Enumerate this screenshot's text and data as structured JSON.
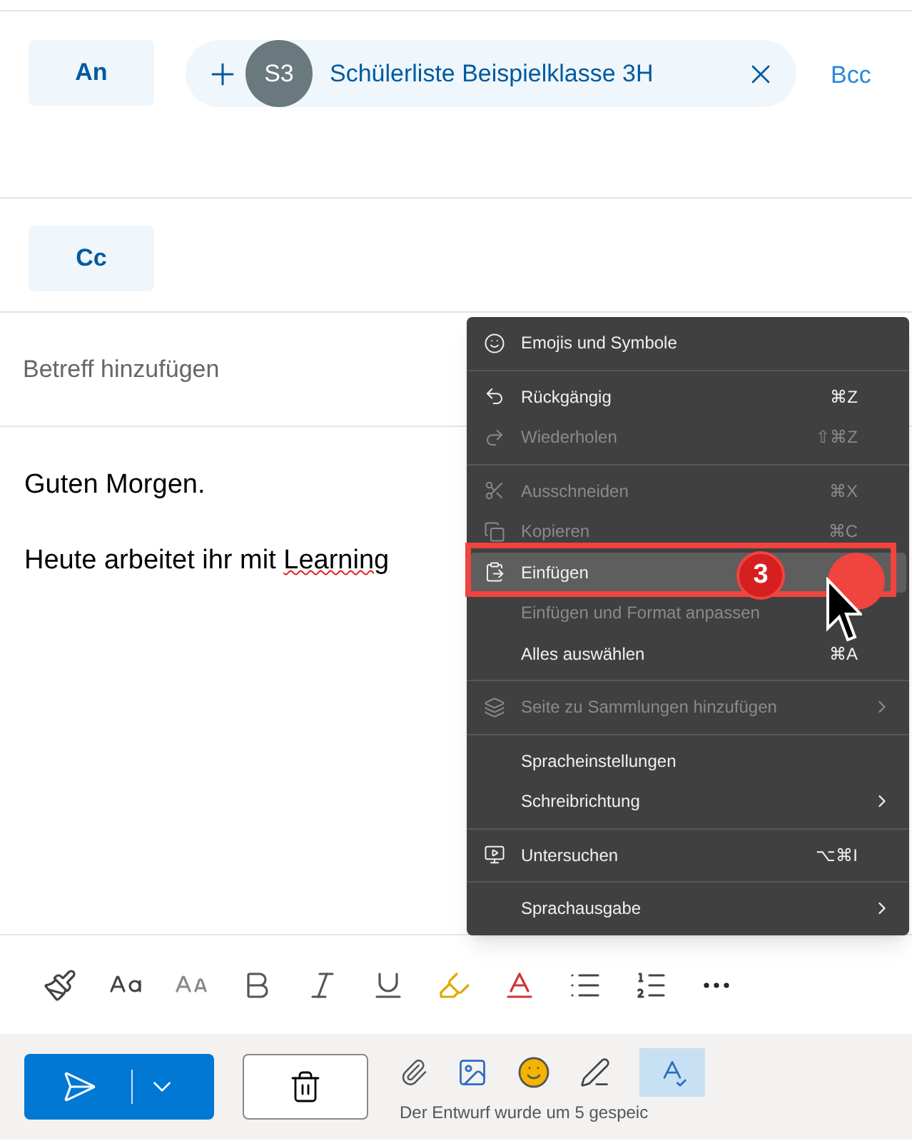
{
  "to": {
    "label": "An",
    "recipient": {
      "initials": "S3",
      "name": "Schülerliste Beispielklasse 3H"
    },
    "bcc": "Bcc"
  },
  "cc": {
    "label": "Cc"
  },
  "subject": {
    "placeholder": "Betreff hinzufügen"
  },
  "body": {
    "greeting": "Guten Morgen.",
    "line_start": "Heute arbeitet ihr mit ",
    "misspelled": "Learning"
  },
  "context_menu": [
    {
      "kind": "item",
      "label": "Emojis und Symbole",
      "disabled": false,
      "highlighted": false
    },
    {
      "kind": "separator"
    },
    {
      "kind": "item",
      "label": "Rückgängig",
      "shortcut": "⌘Z",
      "disabled": false,
      "highlighted": false
    },
    {
      "kind": "item",
      "label": "Wiederholen",
      "shortcut": "⇧⌘Z",
      "disabled": true,
      "highlighted": false
    },
    {
      "kind": "separator"
    },
    {
      "kind": "item",
      "label": "Ausschneiden",
      "shortcut": "⌘X",
      "disabled": true,
      "highlighted": false
    },
    {
      "kind": "item",
      "label": "Kopieren",
      "shortcut": "⌘C",
      "disabled": true,
      "highlighted": false
    },
    {
      "kind": "item",
      "label": "Einfügen",
      "disabled": false,
      "highlighted": true
    },
    {
      "kind": "item",
      "label": "Einfügen und Format anpassen",
      "disabled": true,
      "highlighted": false
    },
    {
      "kind": "item",
      "label": "Alles auswählen",
      "shortcut": "⌘A",
      "disabled": false,
      "highlighted": false
    },
    {
      "kind": "separator"
    },
    {
      "kind": "item",
      "label": "Seite zu Sammlungen hinzufügen",
      "submenu": true,
      "disabled": true,
      "highlighted": false
    },
    {
      "kind": "separator"
    },
    {
      "kind": "item",
      "label": "Spracheinstellungen",
      "disabled": false,
      "highlighted": false
    },
    {
      "kind": "item",
      "label": "Schreibrichtung",
      "submenu": true,
      "disabled": false,
      "highlighted": false
    },
    {
      "kind": "separator"
    },
    {
      "kind": "item",
      "label": "Untersuchen",
      "shortcut": "⌥⌘I",
      "disabled": false,
      "highlighted": false
    },
    {
      "kind": "separator"
    },
    {
      "kind": "item",
      "label": "Sprachausgabe",
      "submenu": true,
      "disabled": false,
      "highlighted": false
    }
  ],
  "step_badge": "3",
  "status_text": "Der Entwurf wurde um 5 gespeic"
}
